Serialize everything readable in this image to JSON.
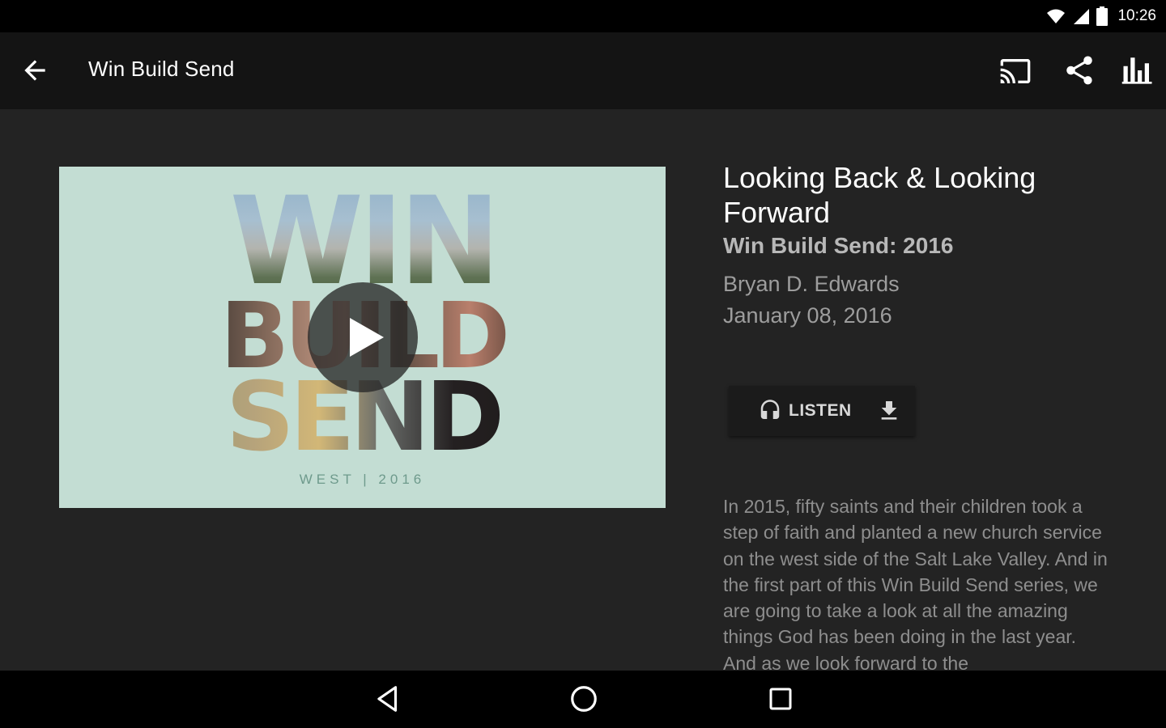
{
  "status_bar": {
    "time": "10:26",
    "icons": [
      "wifi-icon",
      "signal-icon",
      "battery-icon"
    ]
  },
  "toolbar": {
    "back_icon": "arrow-back-icon",
    "title": "Win Build Send",
    "actions": [
      "cast-icon",
      "share-icon",
      "stats-icon"
    ]
  },
  "hero": {
    "word_win": "WIN",
    "word_build": "BUILD",
    "word_send": "SEND",
    "caption": "WEST  |  2016",
    "play_icon": "play-icon"
  },
  "sermon": {
    "title": "Looking Back & Looking Forward",
    "series": "Win Build Send: 2016",
    "speaker": "Bryan D. Edwards",
    "date": "January 08, 2016"
  },
  "actions": {
    "listen_label": "LISTEN",
    "listen_icon": "headphones-icon",
    "download_icon": "download-icon"
  },
  "description": "In 2015, fifty saints and their children took a step of faith and planted a new church service on the west side of the Salt Lake Valley. And in the first part of this Win Build Send series, we are going to take a look at all the amazing things God has been doing in the last year. And as we look forward to the",
  "nav_bar": {
    "icons": [
      "nav-back-icon",
      "nav-home-icon",
      "nav-recents-icon"
    ]
  },
  "colors": {
    "background": "#232323",
    "toolbar": "#141414",
    "hero_bg": "#c3ddd3",
    "accent_text": "#b8b8b8"
  }
}
